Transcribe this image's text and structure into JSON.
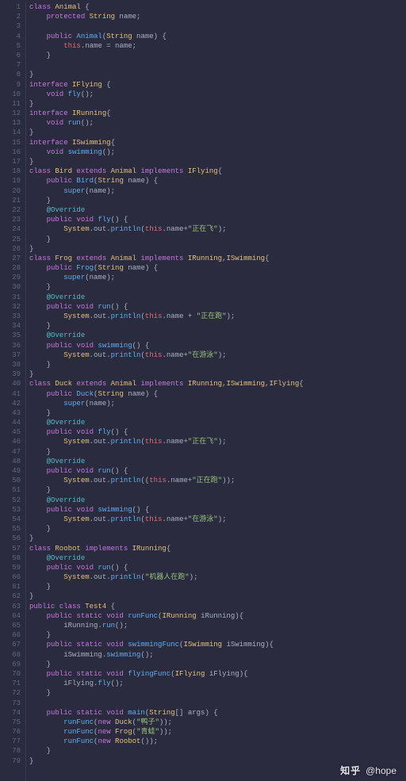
{
  "watermark": {
    "brand": "知乎",
    "user": "@hope"
  },
  "lines": [
    [
      {
        "c": "kw",
        "t": "class "
      },
      {
        "c": "type",
        "t": "Animal"
      },
      {
        "c": "pun",
        "t": " {"
      }
    ],
    [
      {
        "c": "pun",
        "t": "    "
      },
      {
        "c": "kw",
        "t": "protected "
      },
      {
        "c": "type",
        "t": "String"
      },
      {
        "c": "id",
        "t": " name;"
      }
    ],
    [
      {
        "c": "id",
        "t": ""
      }
    ],
    [
      {
        "c": "pun",
        "t": "    "
      },
      {
        "c": "kw",
        "t": "public "
      },
      {
        "c": "fn",
        "t": "Animal"
      },
      {
        "c": "pun",
        "t": "("
      },
      {
        "c": "type",
        "t": "String"
      },
      {
        "c": "id",
        "t": " name"
      },
      {
        "c": "pun",
        "t": ") {"
      }
    ],
    [
      {
        "c": "pun",
        "t": "        "
      },
      {
        "c": "this",
        "t": "this"
      },
      {
        "c": "pun",
        "t": ".name = name;"
      }
    ],
    [
      {
        "c": "pun",
        "t": "    }"
      }
    ],
    [
      {
        "c": "id",
        "t": ""
      }
    ],
    [
      {
        "c": "pun",
        "t": "}"
      }
    ],
    [
      {
        "c": "kw",
        "t": "interface "
      },
      {
        "c": "type",
        "t": "IFlying"
      },
      {
        "c": "pun",
        "t": " {"
      }
    ],
    [
      {
        "c": "pun",
        "t": "    "
      },
      {
        "c": "kw",
        "t": "void "
      },
      {
        "c": "fn",
        "t": "fly"
      },
      {
        "c": "pun",
        "t": "();"
      }
    ],
    [
      {
        "c": "pun",
        "t": "}"
      }
    ],
    [
      {
        "c": "kw",
        "t": "interface "
      },
      {
        "c": "type",
        "t": "IRunning"
      },
      {
        "c": "pun",
        "t": "{"
      }
    ],
    [
      {
        "c": "pun",
        "t": "    "
      },
      {
        "c": "kw",
        "t": "void "
      },
      {
        "c": "fn",
        "t": "run"
      },
      {
        "c": "pun",
        "t": "();"
      }
    ],
    [
      {
        "c": "pun",
        "t": "}"
      }
    ],
    [
      {
        "c": "kw",
        "t": "interface "
      },
      {
        "c": "type",
        "t": "ISwimming"
      },
      {
        "c": "pun",
        "t": "{"
      }
    ],
    [
      {
        "c": "pun",
        "t": "    "
      },
      {
        "c": "kw",
        "t": "void "
      },
      {
        "c": "fn",
        "t": "swimming"
      },
      {
        "c": "pun",
        "t": "();"
      }
    ],
    [
      {
        "c": "pun",
        "t": "}"
      }
    ],
    [
      {
        "c": "kw",
        "t": "class "
      },
      {
        "c": "type",
        "t": "Bird"
      },
      {
        "c": "kw",
        "t": " extends "
      },
      {
        "c": "type",
        "t": "Animal"
      },
      {
        "c": "kw",
        "t": " implements "
      },
      {
        "c": "type",
        "t": "IFlying"
      },
      {
        "c": "pun",
        "t": "{"
      }
    ],
    [
      {
        "c": "pun",
        "t": "    "
      },
      {
        "c": "kw",
        "t": "public "
      },
      {
        "c": "fn",
        "t": "Bird"
      },
      {
        "c": "pun",
        "t": "("
      },
      {
        "c": "type",
        "t": "String"
      },
      {
        "c": "id",
        "t": " name"
      },
      {
        "c": "pun",
        "t": ") {"
      }
    ],
    [
      {
        "c": "pun",
        "t": "        "
      },
      {
        "c": "fn",
        "t": "super"
      },
      {
        "c": "pun",
        "t": "(name);"
      }
    ],
    [
      {
        "c": "pun",
        "t": "    }"
      }
    ],
    [
      {
        "c": "pun",
        "t": "    "
      },
      {
        "c": "ann",
        "t": "@Override"
      }
    ],
    [
      {
        "c": "pun",
        "t": "    "
      },
      {
        "c": "kw",
        "t": "public void "
      },
      {
        "c": "fn",
        "t": "fly"
      },
      {
        "c": "pun",
        "t": "() {"
      }
    ],
    [
      {
        "c": "pun",
        "t": "        "
      },
      {
        "c": "type",
        "t": "System"
      },
      {
        "c": "pun",
        "t": "."
      },
      {
        "c": "id",
        "t": "out"
      },
      {
        "c": "pun",
        "t": "."
      },
      {
        "c": "fn",
        "t": "println"
      },
      {
        "c": "pun",
        "t": "("
      },
      {
        "c": "this",
        "t": "this"
      },
      {
        "c": "pun",
        "t": ".name+"
      },
      {
        "c": "str",
        "t": "\"正在飞\""
      },
      {
        "c": "pun",
        "t": ");"
      }
    ],
    [
      {
        "c": "pun",
        "t": "    }"
      }
    ],
    [
      {
        "c": "pun",
        "t": "}"
      }
    ],
    [
      {
        "c": "kw",
        "t": "class "
      },
      {
        "c": "type",
        "t": "Frog"
      },
      {
        "c": "kw",
        "t": " extends "
      },
      {
        "c": "type",
        "t": "Animal"
      },
      {
        "c": "kw",
        "t": " implements "
      },
      {
        "c": "type",
        "t": "IRunning"
      },
      {
        "c": "pun",
        "t": ","
      },
      {
        "c": "type",
        "t": "ISwimming"
      },
      {
        "c": "pun",
        "t": "{"
      }
    ],
    [
      {
        "c": "pun",
        "t": "    "
      },
      {
        "c": "kw",
        "t": "public "
      },
      {
        "c": "fn",
        "t": "Frog"
      },
      {
        "c": "pun",
        "t": "("
      },
      {
        "c": "type",
        "t": "String"
      },
      {
        "c": "id",
        "t": " name"
      },
      {
        "c": "pun",
        "t": ") {"
      }
    ],
    [
      {
        "c": "pun",
        "t": "        "
      },
      {
        "c": "fn",
        "t": "super"
      },
      {
        "c": "pun",
        "t": "(name);"
      }
    ],
    [
      {
        "c": "pun",
        "t": "    }"
      }
    ],
    [
      {
        "c": "pun",
        "t": "    "
      },
      {
        "c": "ann",
        "t": "@Override"
      }
    ],
    [
      {
        "c": "pun",
        "t": "    "
      },
      {
        "c": "kw",
        "t": "public void "
      },
      {
        "c": "fn",
        "t": "run"
      },
      {
        "c": "pun",
        "t": "() {"
      }
    ],
    [
      {
        "c": "pun",
        "t": "        "
      },
      {
        "c": "type",
        "t": "System"
      },
      {
        "c": "pun",
        "t": "."
      },
      {
        "c": "id",
        "t": "out"
      },
      {
        "c": "pun",
        "t": "."
      },
      {
        "c": "fn",
        "t": "println"
      },
      {
        "c": "pun",
        "t": "("
      },
      {
        "c": "this",
        "t": "this"
      },
      {
        "c": "pun",
        "t": ".name + "
      },
      {
        "c": "str",
        "t": "\"正在跑\""
      },
      {
        "c": "pun",
        "t": ");"
      }
    ],
    [
      {
        "c": "pun",
        "t": "    }"
      }
    ],
    [
      {
        "c": "pun",
        "t": "    "
      },
      {
        "c": "ann",
        "t": "@Override"
      }
    ],
    [
      {
        "c": "pun",
        "t": "    "
      },
      {
        "c": "kw",
        "t": "public void "
      },
      {
        "c": "fn",
        "t": "swimming"
      },
      {
        "c": "pun",
        "t": "() {"
      }
    ],
    [
      {
        "c": "pun",
        "t": "        "
      },
      {
        "c": "type",
        "t": "System"
      },
      {
        "c": "pun",
        "t": "."
      },
      {
        "c": "id",
        "t": "out"
      },
      {
        "c": "pun",
        "t": "."
      },
      {
        "c": "fn",
        "t": "println"
      },
      {
        "c": "pun",
        "t": "("
      },
      {
        "c": "this",
        "t": "this"
      },
      {
        "c": "pun",
        "t": ".name+"
      },
      {
        "c": "str",
        "t": "\"在游泳\""
      },
      {
        "c": "pun",
        "t": ");"
      }
    ],
    [
      {
        "c": "pun",
        "t": "    }"
      }
    ],
    [
      {
        "c": "pun",
        "t": "}"
      }
    ],
    [
      {
        "c": "kw",
        "t": "class "
      },
      {
        "c": "type",
        "t": "Duck"
      },
      {
        "c": "kw",
        "t": " extends "
      },
      {
        "c": "type",
        "t": "Animal"
      },
      {
        "c": "kw",
        "t": " implements "
      },
      {
        "c": "type",
        "t": "IRunning"
      },
      {
        "c": "pun",
        "t": ","
      },
      {
        "c": "type",
        "t": "ISwimming"
      },
      {
        "c": "pun",
        "t": ","
      },
      {
        "c": "type",
        "t": "IFlying"
      },
      {
        "c": "pun",
        "t": "{"
      }
    ],
    [
      {
        "c": "pun",
        "t": "    "
      },
      {
        "c": "kw",
        "t": "public "
      },
      {
        "c": "fn",
        "t": "Duck"
      },
      {
        "c": "pun",
        "t": "("
      },
      {
        "c": "type",
        "t": "String"
      },
      {
        "c": "id",
        "t": " name"
      },
      {
        "c": "pun",
        "t": ") {"
      }
    ],
    [
      {
        "c": "pun",
        "t": "        "
      },
      {
        "c": "fn",
        "t": "super"
      },
      {
        "c": "pun",
        "t": "(name);"
      }
    ],
    [
      {
        "c": "pun",
        "t": "    }"
      }
    ],
    [
      {
        "c": "pun",
        "t": "    "
      },
      {
        "c": "ann",
        "t": "@Override"
      }
    ],
    [
      {
        "c": "pun",
        "t": "    "
      },
      {
        "c": "kw",
        "t": "public void "
      },
      {
        "c": "fn",
        "t": "fly"
      },
      {
        "c": "pun",
        "t": "() {"
      }
    ],
    [
      {
        "c": "pun",
        "t": "        "
      },
      {
        "c": "type",
        "t": "System"
      },
      {
        "c": "pun",
        "t": "."
      },
      {
        "c": "id",
        "t": "out"
      },
      {
        "c": "pun",
        "t": "."
      },
      {
        "c": "fn",
        "t": "println"
      },
      {
        "c": "pun",
        "t": "("
      },
      {
        "c": "this",
        "t": "this"
      },
      {
        "c": "pun",
        "t": ".name+"
      },
      {
        "c": "str",
        "t": "\"正在飞\""
      },
      {
        "c": "pun",
        "t": ");"
      }
    ],
    [
      {
        "c": "pun",
        "t": "    }"
      }
    ],
    [
      {
        "c": "pun",
        "t": "    "
      },
      {
        "c": "ann",
        "t": "@Override"
      }
    ],
    [
      {
        "c": "pun",
        "t": "    "
      },
      {
        "c": "kw",
        "t": "public void "
      },
      {
        "c": "fn",
        "t": "run"
      },
      {
        "c": "pun",
        "t": "() {"
      }
    ],
    [
      {
        "c": "pun",
        "t": "        "
      },
      {
        "c": "type",
        "t": "System"
      },
      {
        "c": "pun",
        "t": "."
      },
      {
        "c": "id",
        "t": "out"
      },
      {
        "c": "pun",
        "t": "."
      },
      {
        "c": "fn",
        "t": "println"
      },
      {
        "c": "pun",
        "t": "(("
      },
      {
        "c": "this",
        "t": "this"
      },
      {
        "c": "pun",
        "t": ".name+"
      },
      {
        "c": "str",
        "t": "\"正在跑\""
      },
      {
        "c": "pun",
        "t": "));"
      }
    ],
    [
      {
        "c": "pun",
        "t": "    }"
      }
    ],
    [
      {
        "c": "pun",
        "t": "    "
      },
      {
        "c": "ann",
        "t": "@Override"
      }
    ],
    [
      {
        "c": "pun",
        "t": "    "
      },
      {
        "c": "kw",
        "t": "public void "
      },
      {
        "c": "fn",
        "t": "swimming"
      },
      {
        "c": "pun",
        "t": "() {"
      }
    ],
    [
      {
        "c": "pun",
        "t": "        "
      },
      {
        "c": "type",
        "t": "System"
      },
      {
        "c": "pun",
        "t": "."
      },
      {
        "c": "id",
        "t": "out"
      },
      {
        "c": "pun",
        "t": "."
      },
      {
        "c": "fn",
        "t": "println"
      },
      {
        "c": "pun",
        "t": "("
      },
      {
        "c": "this",
        "t": "this"
      },
      {
        "c": "pun",
        "t": ".name+"
      },
      {
        "c": "str",
        "t": "\"在游泳\""
      },
      {
        "c": "pun",
        "t": ");"
      }
    ],
    [
      {
        "c": "pun",
        "t": "    }"
      }
    ],
    [
      {
        "c": "pun",
        "t": "}"
      }
    ],
    [
      {
        "c": "kw",
        "t": "class "
      },
      {
        "c": "type",
        "t": "Roobot"
      },
      {
        "c": "kw",
        "t": " implements "
      },
      {
        "c": "type",
        "t": "IRunning"
      },
      {
        "c": "pun",
        "t": "{"
      }
    ],
    [
      {
        "c": "pun",
        "t": "    "
      },
      {
        "c": "ann",
        "t": "@Override"
      }
    ],
    [
      {
        "c": "pun",
        "t": "    "
      },
      {
        "c": "kw",
        "t": "public void "
      },
      {
        "c": "fn",
        "t": "run"
      },
      {
        "c": "pun",
        "t": "() {"
      }
    ],
    [
      {
        "c": "pun",
        "t": "        "
      },
      {
        "c": "type",
        "t": "System"
      },
      {
        "c": "pun",
        "t": "."
      },
      {
        "c": "id",
        "t": "out"
      },
      {
        "c": "pun",
        "t": "."
      },
      {
        "c": "fn",
        "t": "println"
      },
      {
        "c": "pun",
        "t": "("
      },
      {
        "c": "str",
        "t": "\"机器人在跑\""
      },
      {
        "c": "pun",
        "t": ");"
      }
    ],
    [
      {
        "c": "pun",
        "t": "    }"
      }
    ],
    [
      {
        "c": "pun",
        "t": "}"
      }
    ],
    [
      {
        "c": "kw",
        "t": "public class "
      },
      {
        "c": "type",
        "t": "Test4"
      },
      {
        "c": "pun",
        "t": " {"
      }
    ],
    [
      {
        "c": "pun",
        "t": "    "
      },
      {
        "c": "kw",
        "t": "public static void "
      },
      {
        "c": "fn",
        "t": "runFunc"
      },
      {
        "c": "pun",
        "t": "("
      },
      {
        "c": "type",
        "t": "IRunning"
      },
      {
        "c": "id",
        "t": " iRunning"
      },
      {
        "c": "pun",
        "t": "){"
      }
    ],
    [
      {
        "c": "pun",
        "t": "        iRunning."
      },
      {
        "c": "fn",
        "t": "run"
      },
      {
        "c": "pun",
        "t": "();"
      }
    ],
    [
      {
        "c": "pun",
        "t": "    }"
      }
    ],
    [
      {
        "c": "pun",
        "t": "    "
      },
      {
        "c": "kw",
        "t": "public static void "
      },
      {
        "c": "fn",
        "t": "swimmingFunc"
      },
      {
        "c": "pun",
        "t": "("
      },
      {
        "c": "type",
        "t": "ISwimming"
      },
      {
        "c": "id",
        "t": " iSwimming"
      },
      {
        "c": "pun",
        "t": "){"
      }
    ],
    [
      {
        "c": "pun",
        "t": "        iSwimming."
      },
      {
        "c": "fn",
        "t": "swimming"
      },
      {
        "c": "pun",
        "t": "();"
      }
    ],
    [
      {
        "c": "pun",
        "t": "    }"
      }
    ],
    [
      {
        "c": "pun",
        "t": "    "
      },
      {
        "c": "kw",
        "t": "public static void "
      },
      {
        "c": "fn",
        "t": "flyingFunc"
      },
      {
        "c": "pun",
        "t": "("
      },
      {
        "c": "type",
        "t": "IFlying"
      },
      {
        "c": "id",
        "t": " iFlying"
      },
      {
        "c": "pun",
        "t": "){"
      }
    ],
    [
      {
        "c": "pun",
        "t": "        iFlying."
      },
      {
        "c": "fn",
        "t": "fly"
      },
      {
        "c": "pun",
        "t": "();"
      }
    ],
    [
      {
        "c": "pun",
        "t": "    }"
      }
    ],
    [
      {
        "c": "id",
        "t": ""
      }
    ],
    [
      {
        "c": "pun",
        "t": "    "
      },
      {
        "c": "kw",
        "t": "public static void "
      },
      {
        "c": "fn",
        "t": "main"
      },
      {
        "c": "pun",
        "t": "("
      },
      {
        "c": "type",
        "t": "String"
      },
      {
        "c": "pun",
        "t": "[] args) {"
      }
    ],
    [
      {
        "c": "pun",
        "t": "        "
      },
      {
        "c": "fn",
        "t": "runFunc"
      },
      {
        "c": "pun",
        "t": "("
      },
      {
        "c": "kw",
        "t": "new "
      },
      {
        "c": "type",
        "t": "Duck"
      },
      {
        "c": "pun",
        "t": "("
      },
      {
        "c": "str",
        "t": "\"鸭子\""
      },
      {
        "c": "pun",
        "t": "));"
      }
    ],
    [
      {
        "c": "pun",
        "t": "        "
      },
      {
        "c": "fn",
        "t": "runFunc"
      },
      {
        "c": "pun",
        "t": "("
      },
      {
        "c": "kw",
        "t": "new "
      },
      {
        "c": "type",
        "t": "Frog"
      },
      {
        "c": "pun",
        "t": "("
      },
      {
        "c": "str",
        "t": "\"青蛙\""
      },
      {
        "c": "pun",
        "t": "));"
      }
    ],
    [
      {
        "c": "pun",
        "t": "        "
      },
      {
        "c": "fn",
        "t": "runFunc"
      },
      {
        "c": "pun",
        "t": "("
      },
      {
        "c": "kw",
        "t": "new "
      },
      {
        "c": "type",
        "t": "Roobot"
      },
      {
        "c": "pun",
        "t": "());"
      }
    ],
    [
      {
        "c": "pun",
        "t": "    }"
      }
    ],
    [
      {
        "c": "pun",
        "t": "}"
      }
    ]
  ]
}
